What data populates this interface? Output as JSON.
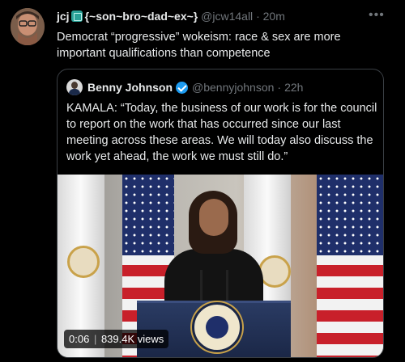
{
  "tweet": {
    "author_name": "jcj",
    "author_suffix": "{~son~bro~dad~ex~}",
    "handle": "@jcw14all",
    "separator": "·",
    "time": "20m",
    "more_label": "•••",
    "text": "Democrat “progressive” wokeism:  race & sex are more important qualifications than competence"
  },
  "quoted": {
    "author_name": "Benny Johnson",
    "handle": "@bennyjohnson",
    "separator": "·",
    "time": "22h",
    "text": "KAMALA:  “Today, the business of our work is for the council to report on the work that has occurred since our last meeting across these areas. We will today also discuss the work yet ahead, the work we must still do.”",
    "video": {
      "duration": "0:06",
      "views": "839.4K views"
    }
  },
  "colors": {
    "background": "#000000",
    "text_primary": "#e7e9ea",
    "text_muted": "#71767b",
    "verified": "#1d9bf0",
    "border": "#3a3f44"
  },
  "icons": [
    "more-icon",
    "verified-icon",
    "emoji-icon"
  ]
}
